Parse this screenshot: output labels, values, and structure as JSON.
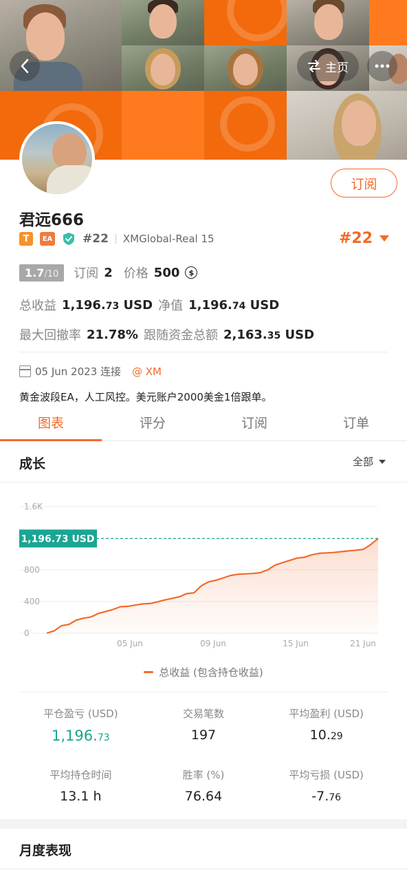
{
  "banner": {
    "home_label": "主页"
  },
  "profile": {
    "subscribe_label": "订阅",
    "name": "君远666",
    "badge_t": "T",
    "badge_ea": "EA",
    "rank": "#22",
    "server": "XMGlobal-Real 15",
    "rank_big": "#22"
  },
  "stats": {
    "score_main": "1.7",
    "score_total": "/10",
    "subs_label": "订阅",
    "subs_value": "2",
    "price_label": "价格",
    "price_value": "500",
    "coin_symbol": "$",
    "total_profit_label": "总收益",
    "total_profit_int": "1,196.",
    "total_profit_dec": "73",
    "total_profit_cur": "USD",
    "equity_label": "净值",
    "equity_int": "1,196.",
    "equity_dec": "74",
    "equity_cur": "USD",
    "drawdown_label": "最大回撤率",
    "drawdown_value": "21.78%",
    "follow_label": "跟随资金总额",
    "follow_int": "2,163.",
    "follow_dec": "35",
    "follow_cur": "USD"
  },
  "info": {
    "joined": "05 Jun 2023 连接",
    "broker": "@ XM",
    "description": "黄金波段EA，人工风控。美元账户2000美金1倍跟单。"
  },
  "tabs": [
    "图表",
    "评分",
    "订阅",
    "订单"
  ],
  "growth": {
    "title": "成长",
    "filter": "全部",
    "legend": "总收益 (包含持仓收益)"
  },
  "chart_data": {
    "type": "area",
    "title": "",
    "xlabel": "",
    "ylabel": "",
    "ylim": [
      0,
      1600
    ],
    "yticks": [
      "0",
      "400",
      "800",
      "1.6K"
    ],
    "xticks": [
      "05 Jun",
      "09 Jun",
      "15 Jun",
      "21 Jun"
    ],
    "current_label": "1,196.73 USD",
    "current_value": 1196.73,
    "line_color": "#f26a2a",
    "marker_color": "#1aa594",
    "series": [
      {
        "values": [
          0,
          30,
          95,
          110,
          165,
          190,
          205,
          250,
          275,
          300,
          335,
          340,
          355,
          370,
          375,
          395,
          420,
          440,
          460,
          500,
          510,
          600,
          650,
          670,
          700,
          730,
          745,
          750,
          755,
          765,
          800,
          860,
          890,
          920,
          950,
          960,
          990,
          1010,
          1015,
          1020,
          1030,
          1040,
          1050,
          1060,
          1120,
          1196.73
        ]
      }
    ]
  },
  "metrics": [
    {
      "label": "平仓盈亏 (USD)",
      "int": "1,196.",
      "dec": "73"
    },
    {
      "label": "交易笔数",
      "int": "197",
      "dec": ""
    },
    {
      "label": "平均盈利 (USD)",
      "int": "10.",
      "dec": "29"
    },
    {
      "label": "平均持仓时间",
      "int": "13.1 h",
      "dec": ""
    },
    {
      "label": "胜率 (%)",
      "int": "76.64",
      "dec": ""
    },
    {
      "label": "平均亏损 (USD)",
      "int": "-7.",
      "dec": "76"
    }
  ],
  "monthly": {
    "title": "月度表现"
  }
}
